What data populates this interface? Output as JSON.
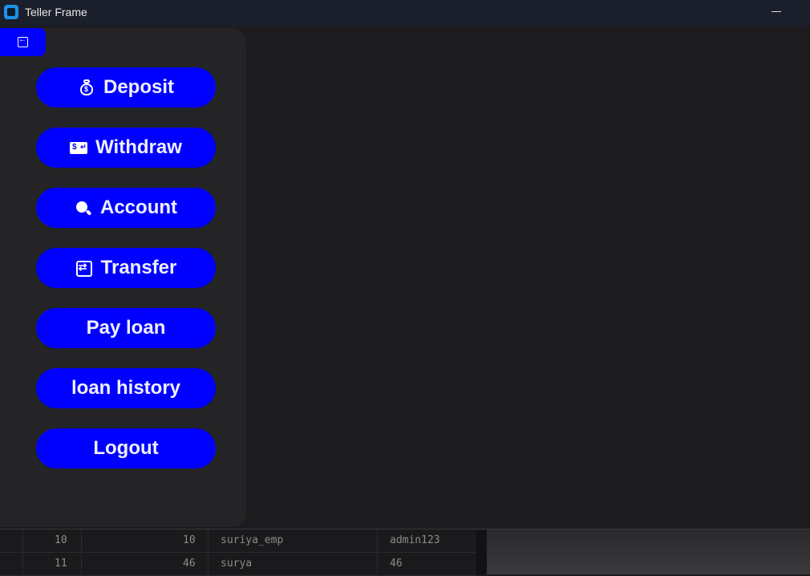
{
  "window": {
    "title": "Teller Frame"
  },
  "sidebar": {
    "buttons": [
      {
        "label": "Deposit",
        "icon": "moneybag-icon"
      },
      {
        "label": "Withdraw",
        "icon": "cash-icon"
      },
      {
        "label": "Account",
        "icon": "search-icon"
      },
      {
        "label": "Transfer",
        "icon": "transfer-icon"
      },
      {
        "label": "Pay loan",
        "icon": ""
      },
      {
        "label": "loan history",
        "icon": ""
      },
      {
        "label": "Logout",
        "icon": ""
      }
    ]
  },
  "background_table": {
    "rows": [
      [
        "10",
        "10",
        "suriya_emp",
        "admin123"
      ],
      [
        "11",
        "46",
        "surya",
        "46"
      ]
    ]
  },
  "colors": {
    "accent": "#0000ff",
    "sidebar": "#242426",
    "background": "#1c1c1e"
  }
}
